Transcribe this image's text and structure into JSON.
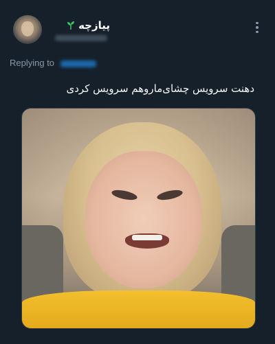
{
  "tweet": {
    "author": {
      "display_name": "پیازچه",
      "badge_icon": "sprout-icon",
      "badge_color": "#3fbf5f"
    },
    "replying_label": "Replying to",
    "text": "دهنت سرویس چشای‌ماروهم سرویس کردی",
    "menu_icon": "more-vertical-icon",
    "media_icon": "photo-icon"
  },
  "colors": {
    "background": "#15202b",
    "secondary_text": "#8b98a5",
    "link": "#1d9bf0"
  }
}
